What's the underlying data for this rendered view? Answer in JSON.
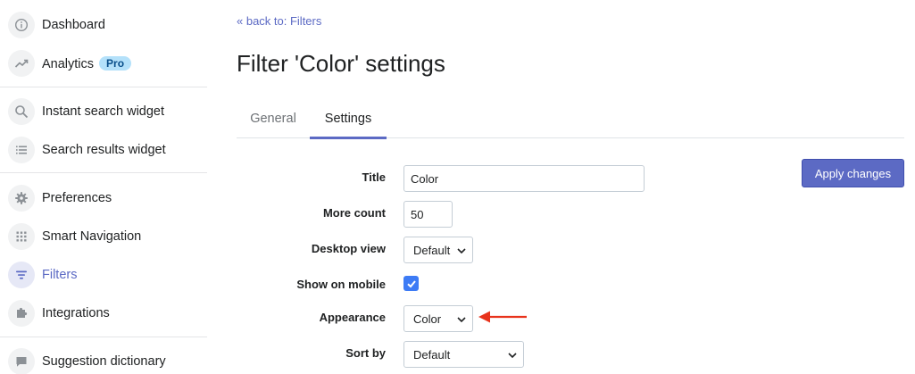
{
  "sidebar": {
    "items": [
      {
        "label": "Dashboard",
        "icon": "info-icon"
      },
      {
        "label": "Analytics",
        "icon": "trending-up-icon",
        "badge": "Pro"
      },
      {
        "label": "Instant search widget",
        "icon": "search-icon"
      },
      {
        "label": "Search results widget",
        "icon": "list-icon"
      },
      {
        "label": "Preferences",
        "icon": "gear-icon"
      },
      {
        "label": "Smart Navigation",
        "icon": "grid-icon"
      },
      {
        "label": "Filters",
        "icon": "filter-icon",
        "active": true
      },
      {
        "label": "Integrations",
        "icon": "puzzle-icon"
      },
      {
        "label": "Suggestion dictionary",
        "icon": "chat-icon"
      }
    ]
  },
  "header": {
    "back_link": "« back to: Filters",
    "title": "Filter 'Color' settings"
  },
  "tabs": [
    {
      "label": "General",
      "active": false
    },
    {
      "label": "Settings",
      "active": true
    }
  ],
  "form": {
    "title_label": "Title",
    "title_value": "Color",
    "more_count_label": "More count",
    "more_count_value": "50",
    "desktop_view_label": "Desktop view",
    "desktop_view_value": "Default",
    "show_on_mobile_label": "Show on mobile",
    "show_on_mobile_checked": true,
    "appearance_label": "Appearance",
    "appearance_value": "Color",
    "sort_by_label": "Sort by",
    "sort_by_value": "Default"
  },
  "actions": {
    "apply_label": "Apply changes"
  },
  "colors": {
    "accent": "#5c6ac4",
    "checkbox": "#3d7bf5",
    "arrow": "#e8331c",
    "badge_bg": "#b4e1fa"
  }
}
